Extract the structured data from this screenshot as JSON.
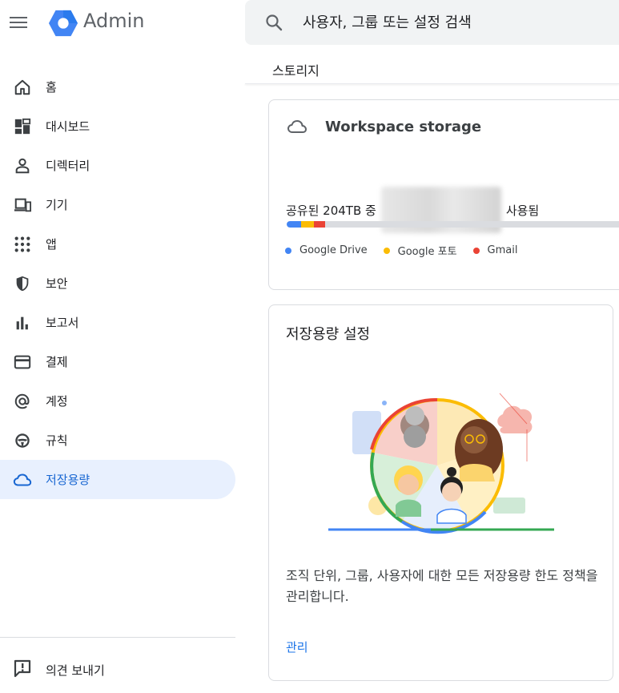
{
  "header": {
    "brand": "Admin",
    "search_placeholder": "사용자, 그룹 또는 설정 검색",
    "page_title": "스토리지"
  },
  "sidebar": {
    "items": [
      {
        "label": "홈",
        "icon": "home-icon"
      },
      {
        "label": "대시보드",
        "icon": "dashboard-icon"
      },
      {
        "label": "디렉터리",
        "icon": "person-icon"
      },
      {
        "label": "기기",
        "icon": "devices-icon"
      },
      {
        "label": "앱",
        "icon": "apps-grid-icon"
      },
      {
        "label": "보안",
        "icon": "shield-icon"
      },
      {
        "label": "보고서",
        "icon": "bar-chart-icon"
      },
      {
        "label": "결제",
        "icon": "credit-card-icon"
      },
      {
        "label": "계정",
        "icon": "at-sign-icon"
      },
      {
        "label": "규칙",
        "icon": "steering-icon"
      },
      {
        "label": "저장용량",
        "icon": "cloud-icon",
        "active": true
      }
    ],
    "feedback_label": "의견 보내기"
  },
  "storage_card": {
    "title": "Workspace storage",
    "usage_prefix": "공유된 204TB 중",
    "usage_suffix": "사용됨",
    "legend": [
      {
        "label": "Google Drive",
        "color": "#4285f4"
      },
      {
        "label": "Google 포토",
        "color": "#fbbc04"
      },
      {
        "label": "Gmail",
        "color": "#ea4335"
      }
    ]
  },
  "settings_card": {
    "title": "저장용량 설정",
    "description": "조직 단위, 그룹, 사용자에 대한 모든 저장용량 한도 정책을 관리합니다.",
    "link_label": "관리"
  },
  "colors": {
    "accent": "#1a73e8",
    "active_bg": "#e8f0fe",
    "drive": "#4285f4",
    "photos": "#fbbc04",
    "gmail": "#ea4335"
  }
}
